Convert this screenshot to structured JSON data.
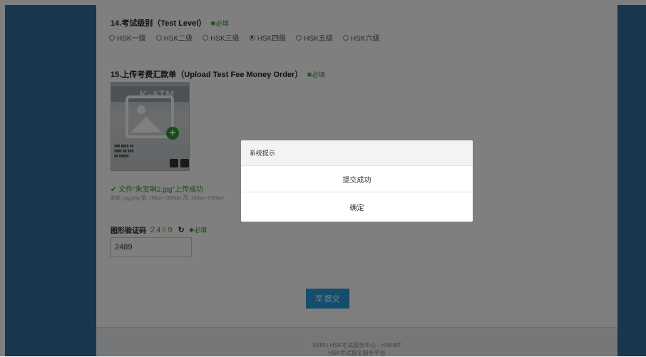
{
  "form": {
    "q14": {
      "title": "14.考试级别（Test Level）",
      "required": "✱必填",
      "options": [
        "HSK一级",
        "HSK二级",
        "HSK三级",
        "HSK四级",
        "HSK五级",
        "HSK六级"
      ],
      "selected": "HSK四级"
    },
    "q15": {
      "title": "15.上传考费汇款单（Upload Test Fee Money Order）",
      "required": "✱必填",
      "thumb_text": "K-ATM",
      "upload_status": "✔ 文件\"朱宝琳2.jpg\"上传成功",
      "upload_hint": "类型: jpg,png 宽: 100px~1000px 高: 100px~1000px"
    },
    "captcha": {
      "label": "图形验证码",
      "code": [
        "2",
        "4",
        "8",
        "9"
      ],
      "refresh_icon": "↻",
      "required": "✱必填",
      "value": "2489"
    },
    "submit": {
      "icon": "🖫",
      "label": "提交"
    }
  },
  "footer": {
    "line1": "SSRU-HSK考试服务中心 - HSKIBT",
    "line2": "HSK考试报名服务平台"
  },
  "modal": {
    "title": "系统提示",
    "message": "提交成功",
    "ok_label": "确定"
  },
  "colors": {
    "side_bg": "#2f6f9f",
    "required_green": "#2a9d2a",
    "submit_blue": "#2a9bd8"
  }
}
